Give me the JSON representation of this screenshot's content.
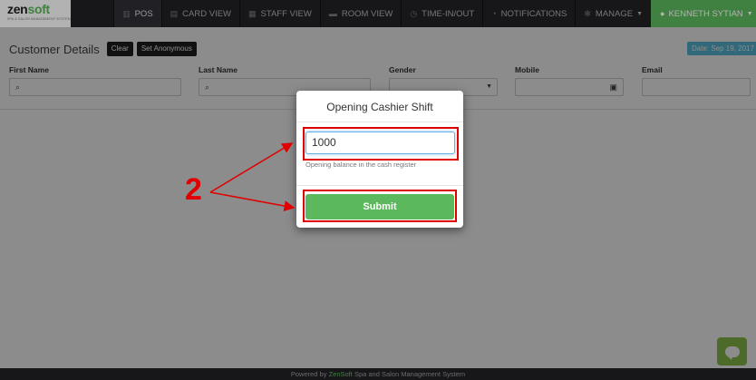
{
  "brand": {
    "zen": "zen",
    "soft": "soft",
    "tagline": "SPA & SALON MANAGEMENT SYSTEM"
  },
  "nav": {
    "items": [
      {
        "label": "POS",
        "icon": "chart-icon",
        "active": true
      },
      {
        "label": "CARD VIEW",
        "icon": "card-icon",
        "active": false
      },
      {
        "label": "STAFF VIEW",
        "icon": "calendar-icon",
        "active": false
      },
      {
        "label": "ROOM VIEW",
        "icon": "bed-icon",
        "active": false
      },
      {
        "label": "TIME-IN/OUT",
        "icon": "clock-icon",
        "active": false
      },
      {
        "label": "NOTIFICATIONS",
        "icon": "bell-icon",
        "active": false
      },
      {
        "label": "MANAGE",
        "icon": "gear-icon",
        "active": false
      }
    ],
    "user": "KENNETH SYTIAN"
  },
  "customer": {
    "title": "Customer Details",
    "clear_label": "Clear",
    "anonymous_label": "Set Anonymous",
    "date_label": "Date: Sep 19, 2017",
    "fields": {
      "first_name": "First Name",
      "last_name": "Last Name",
      "gender": "Gender",
      "mobile": "Mobile",
      "email": "Email"
    }
  },
  "modal": {
    "title": "Opening Cashier Shift",
    "amount_value": "1000",
    "help_text": "Opening balance in the cash register",
    "submit_label": "Submit"
  },
  "annotation": {
    "step": "2",
    "color": "#e00000"
  },
  "footer": {
    "prefix": "Powered by",
    "brand": "ZenSoft",
    "suffix": "Spa and Salon Management System"
  },
  "colors": {
    "accent": "#5cb85c",
    "info": "#5bc0de",
    "nav_bg": "#222226"
  }
}
